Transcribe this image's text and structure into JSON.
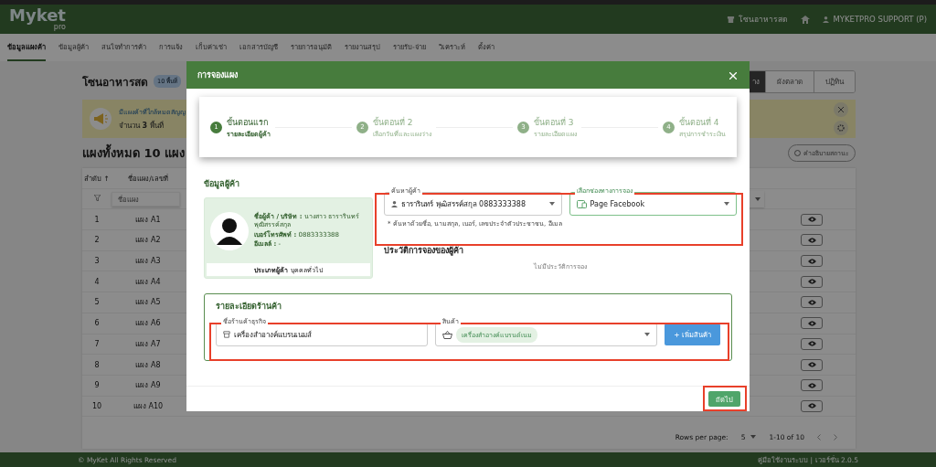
{
  "header": {
    "logo": "Myket",
    "logo_sub": "pro",
    "zone": "โซนอาหารสด",
    "user": "MYKETPRO SUPPORT (P)"
  },
  "nav": [
    {
      "label": "ข้อมูลแผงค้า",
      "selected": true
    },
    {
      "label": "ข้อมูลผู้ค้า",
      "selected": false
    },
    {
      "label": "สนใจทำการค้า",
      "selected": false
    },
    {
      "label": "การแจ้ง",
      "selected": false
    },
    {
      "label": "เก็บค่าเช่า",
      "selected": false
    },
    {
      "label": "เอกสารบัญชี",
      "selected": false
    },
    {
      "label": "รายการอนุมัติ",
      "selected": false
    },
    {
      "label": "รายงานสรุป",
      "selected": false
    },
    {
      "label": "รายรับ-จ่าย",
      "selected": false
    },
    {
      "label": "วิเคราะห์",
      "selected": false
    },
    {
      "label": "ตั้งค่า",
      "selected": false
    }
  ],
  "page": {
    "title": "โซนอาหารสด",
    "badge": "10 พื้นที่",
    "view_buttons": [
      {
        "label": "าง",
        "selected": true
      },
      {
        "label": "ผังตลาด",
        "selected": false
      },
      {
        "label": "ปฏิทิน",
        "selected": false
      }
    ],
    "alert": {
      "title": "มีแผงค้าที่ใกล้หมดสัญญ",
      "text": "จำนวน **3** พื้นที่"
    },
    "status_button": "คำอธิบายสถานะ",
    "heading": "แผงทั้งหมด 10 แผง"
  },
  "table": {
    "columns": [
      "ลำดับ ↑",
      "ชื่อแผง/เลขที่"
    ],
    "filter_placeholder": "ชื่อแผง",
    "rows": [
      {
        "no": "1",
        "name": "แผง A1"
      },
      {
        "no": "2",
        "name": "แผง A2"
      },
      {
        "no": "3",
        "name": "แผง A3"
      },
      {
        "no": "4",
        "name": "แผง A4"
      },
      {
        "no": "5",
        "name": "แผง A5"
      },
      {
        "no": "6",
        "name": "แผง A6"
      },
      {
        "no": "7",
        "name": "แผง A7"
      },
      {
        "no": "8",
        "name": "แผง A8"
      },
      {
        "no": "9",
        "name": "แผง A9"
      },
      {
        "no": "10",
        "name": "แผง A10"
      }
    ],
    "rows_per_page_label": "Rows per page:",
    "rows_per_page": "5",
    "range": "1-10 of 10"
  },
  "footer": {
    "copyright": "© MyKet All Rights Reserved",
    "version": "คู่มือใช้งานระบบ | เวอร์ชั่น 2.0.5"
  },
  "modal": {
    "title": "การจองแผง",
    "steps": [
      {
        "number": "1",
        "title": "ขั้นตอนแรก",
        "subtitle": "รายละเอียดผู้ค้า",
        "selected": true
      },
      {
        "number": "2",
        "title": "ขั้นตอนที่ 2",
        "subtitle": "เลือกวันที่และแผงว่าง",
        "selected": false
      },
      {
        "number": "3",
        "title": "ขั้นตอนที่ 3",
        "subtitle": "รายละเอียดแผง",
        "selected": false
      },
      {
        "number": "4",
        "title": "ขั้นตอนที่ 4",
        "subtitle": "สรุปการชำระเงิน",
        "selected": false
      }
    ],
    "vendor_heading": "ข้อมูลผู้ค้า",
    "vendor": {
      "name": "**ชื่อผู้ค้า / บริษัท :** นางสาว ธารารินทร์ พุฒิสรรค์สกุล",
      "phone": "**เบอร์โทรศัพท์ :** 0883333388",
      "email": "**อีเมลล์ :** -",
      "type": "**ประเภทผู้ค้า** บุคคลทั่วไป"
    },
    "search_field": {
      "label": "ค้นหาผู้ค้า",
      "value": "ธารารินทร์ พุฒิสรรค์สกุล 0883333388",
      "helper": "* ค้นหาด้วยชื่อ, นามสกุล, เบอร์, เลขประจำตัวประชาชน, อีเมล"
    },
    "channel_field": {
      "label": "เลือกช่องทางการจอง",
      "value": "Page Facebook"
    },
    "history_heading": "ประวัติการจองของผู้ค้า",
    "history_empty": "ไม่มีประวัติการจอง",
    "store_heading": "รายละเอียดร้านค้า",
    "store_field": {
      "label": "ชื่อร้านค้าธุรกิจ",
      "value": "เครื่องสำอางค์แบรนเนมส์"
    },
    "product_field": {
      "label": "สินค้า",
      "chips": [
        "เครื่องสำอางค์แบรนด์เนม"
      ]
    },
    "add_product": "+ เพิ่มสินค้า",
    "next": "ถัดไป"
  }
}
